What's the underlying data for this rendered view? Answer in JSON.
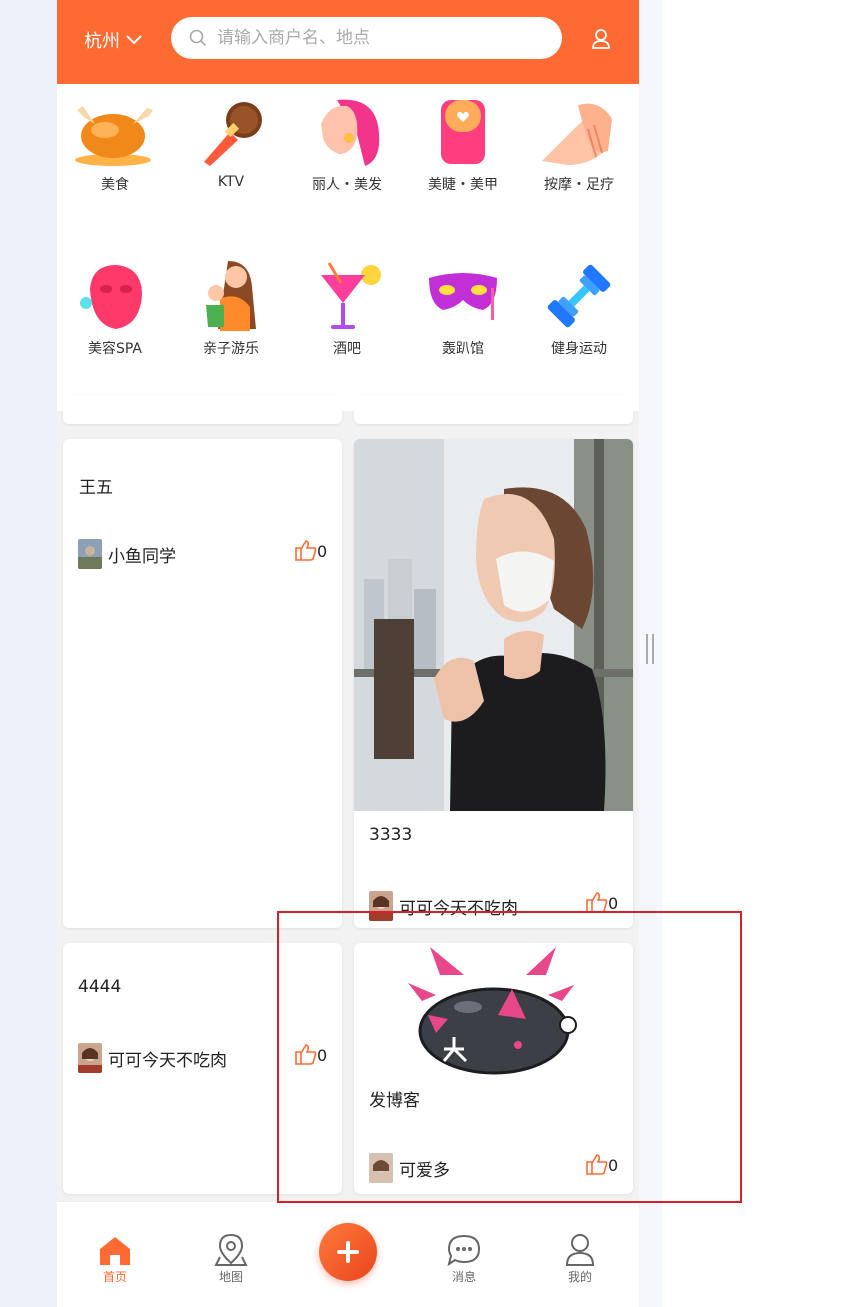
{
  "header": {
    "city": "杭州",
    "search_placeholder": "请输入商户名、地点"
  },
  "categories": [
    {
      "label": "美食",
      "icon": "roast-chicken-icon"
    },
    {
      "label": "KTV",
      "icon": "microphone-icon"
    },
    {
      "label": "丽人・美发",
      "icon": "woman-hair-icon"
    },
    {
      "label": "美睫・美甲",
      "icon": "nail-icon"
    },
    {
      "label": "按摩・足疗",
      "icon": "massage-hands-icon"
    },
    {
      "label": "美容SPA",
      "icon": "face-mask-icon"
    },
    {
      "label": "亲子游乐",
      "icon": "mother-child-icon"
    },
    {
      "label": "酒吧",
      "icon": "cocktail-icon"
    },
    {
      "label": "轰趴馆",
      "icon": "party-mask-icon"
    },
    {
      "label": "健身运动",
      "icon": "dumbbell-icon"
    }
  ],
  "feed": [
    {
      "title": "王五",
      "author": "小鱼同学",
      "likes": "0"
    },
    {
      "title": "3333",
      "author": "可可今天不吃肉",
      "likes": "0"
    },
    {
      "title": "4444",
      "author": "可可今天不吃肉",
      "likes": "0"
    },
    {
      "title": "发博客",
      "author": "可爱多",
      "likes": "0"
    }
  ],
  "tabbar": [
    {
      "label": "首页",
      "icon": "home-icon",
      "active": true
    },
    {
      "label": "地图",
      "icon": "map-pin-icon"
    },
    {
      "label": "消息",
      "icon": "chat-icon"
    },
    {
      "label": "我的",
      "icon": "profile-icon"
    }
  ],
  "colors": {
    "accent": "#ff6a33",
    "annotation": "#d9202a"
  }
}
